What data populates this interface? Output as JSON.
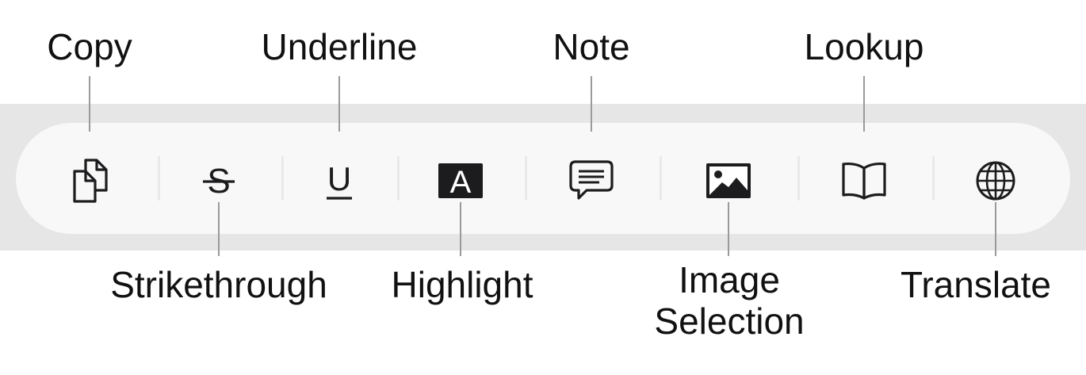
{
  "toolbar": {
    "items": [
      {
        "id": "copy",
        "label": "Copy",
        "icon": "copy-icon"
      },
      {
        "id": "strikethrough",
        "label": "Strikethrough",
        "icon": "strikethrough-icon",
        "glyph": "S"
      },
      {
        "id": "underline",
        "label": "Underline",
        "icon": "underline-icon",
        "glyph": "U"
      },
      {
        "id": "highlight",
        "label": "Highlight",
        "icon": "highlight-icon",
        "glyph": "A"
      },
      {
        "id": "note",
        "label": "Note",
        "icon": "note-icon"
      },
      {
        "id": "image-selection",
        "label_line1": "Image",
        "label_line2": "Selection",
        "icon": "image-icon"
      },
      {
        "id": "lookup",
        "label": "Lookup",
        "icon": "book-icon"
      },
      {
        "id": "translate",
        "label": "Translate",
        "icon": "globe-icon"
      }
    ]
  },
  "colors": {
    "band": "#e6e6e6",
    "toolbar": "#f8f8f8",
    "icon": "#1c1c1e",
    "leader": "#9a9a9a",
    "separator": "#e9e9e9"
  }
}
